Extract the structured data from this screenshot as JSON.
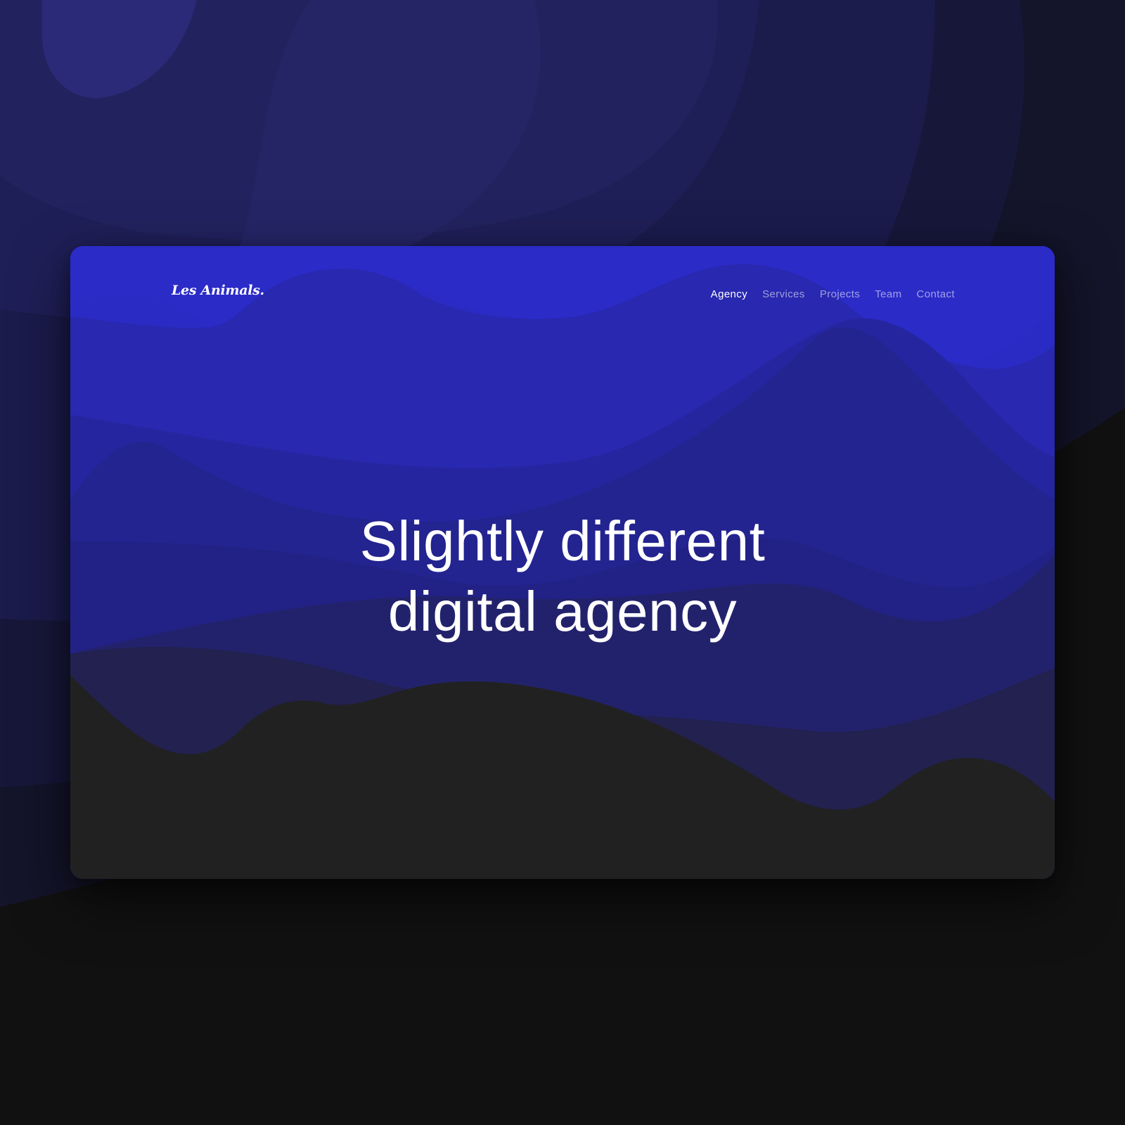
{
  "colors": {
    "page_background": "#111111",
    "card_top": "#2a2bc4",
    "card_bottom": "#212121",
    "text_primary": "#ffffff",
    "nav_inactive": "#9d9ec9"
  },
  "brand": {
    "logo_text": "Les Animals."
  },
  "nav": {
    "items": [
      {
        "label": "Agency",
        "active": true
      },
      {
        "label": "Services",
        "active": false
      },
      {
        "label": "Projects",
        "active": false
      },
      {
        "label": "Team",
        "active": false
      },
      {
        "label": "Contact",
        "active": false
      }
    ]
  },
  "hero": {
    "line1": "Slightly different",
    "line2": "digital agency"
  }
}
